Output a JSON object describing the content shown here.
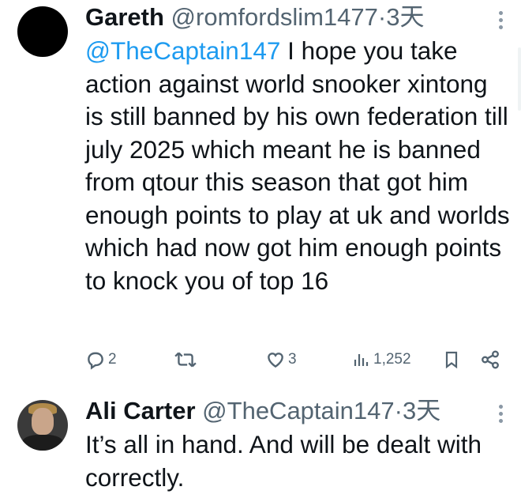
{
  "tweets": [
    {
      "author_name": "Gareth",
      "author_handle": "@romfordslim1477",
      "separator": "·",
      "time": "3天",
      "mention": "@TheCaptain147",
      "text": " I hope you take action against world snooker xintong is still banned by his own federation till july 2025 which meant he is banned from qtour this season that got him enough points to play at uk and worlds which had now got him enough points to knock you of top 16",
      "actions": {
        "replies": "2",
        "retweets": "",
        "likes": "3",
        "views": "1,252"
      },
      "icons": [
        "reply-icon",
        "retweet-icon",
        "like-icon",
        "views-icon",
        "bookmark-icon",
        "share-icon"
      ]
    },
    {
      "author_name": "Ali Carter",
      "author_handle": "@TheCaptain147",
      "separator": "·",
      "time": "3天",
      "text": "It’s all in hand. And will be dealt with correctly."
    }
  ],
  "colors": {
    "text": "#0f1419",
    "secondary": "#536471",
    "link": "#1d9bf0"
  }
}
